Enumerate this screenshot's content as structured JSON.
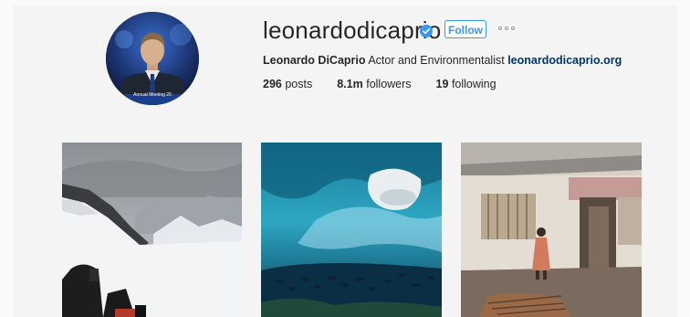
{
  "profile": {
    "username": "leonardodicaprio",
    "full_name": "Leonardo DiCaprio",
    "bio": "Actor and Environmentalist",
    "website": "leonardodicaprio.org",
    "follow_label": "Follow",
    "verified": true,
    "avatar_caption": "Annual Meeting 20"
  },
  "stats": [
    {
      "value": "296",
      "label": "posts"
    },
    {
      "value": "8.1m",
      "label": "followers"
    },
    {
      "value": "19",
      "label": "following"
    }
  ],
  "posts": [
    {
      "subject": "snowy-mountain-photo"
    },
    {
      "subject": "underwater-polar-bear-photo"
    },
    {
      "subject": "child-by-house-photo"
    }
  ],
  "colors": {
    "accent": "#3897f0",
    "link": "#003569",
    "text": "#262626"
  }
}
